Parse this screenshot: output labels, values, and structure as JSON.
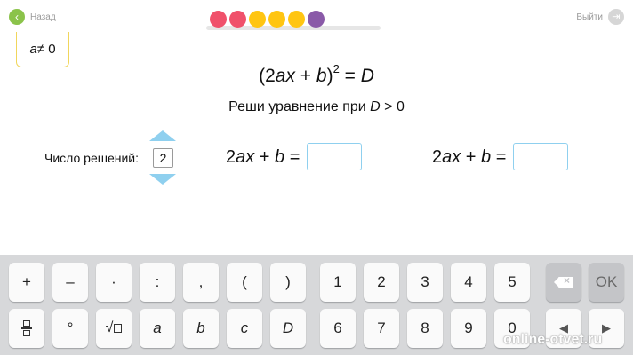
{
  "nav": {
    "back_label": "Назад",
    "back_icon": "chevron-left-icon",
    "exit_label": "Выйти",
    "exit_icon": "exit-icon"
  },
  "progress": {
    "dots": [
      "#f0516b",
      "#f0516b",
      "#ffc512",
      "#ffc512",
      "#ffc512",
      "#8a5aa8"
    ]
  },
  "condition": {
    "var": "a",
    "rest": " ≠ 0"
  },
  "equation": {
    "open": "(2",
    "a": "a",
    "x": "x",
    "plus": " + ",
    "b": "b",
    "close": ")",
    "power": "2",
    "equals": " = ",
    "d": "D"
  },
  "task": {
    "text": "Реши уравнение при ",
    "var": "D",
    "cond": " > 0"
  },
  "solutions": {
    "label": "Число решений:",
    "value": "2"
  },
  "answers": [
    {
      "lhs_pre": "2",
      "a": "a",
      "x": "x",
      "plus": " + ",
      "b": "b",
      "eq": " =",
      "value": ""
    },
    {
      "lhs_pre": "2",
      "a": "a",
      "x": "x",
      "plus": " + ",
      "b": "b",
      "eq": " =",
      "value": ""
    }
  ],
  "keyboard": {
    "row1": [
      "+",
      "–",
      "·",
      ":",
      ",",
      "(",
      ")",
      "1",
      "2",
      "3",
      "4",
      "5"
    ],
    "row1_backspace_icon": "backspace-icon",
    "ok": "OK",
    "row2_fraction_icon": "fraction-icon",
    "row2": [
      "°",
      "a",
      "b",
      "c",
      "D",
      "6",
      "7",
      "8",
      "9",
      "0"
    ],
    "row2_sqrt_icon": "sqrt-icon",
    "left_arrow": "◀",
    "right_arrow": "▶"
  },
  "watermark": "online-otvet.ru"
}
